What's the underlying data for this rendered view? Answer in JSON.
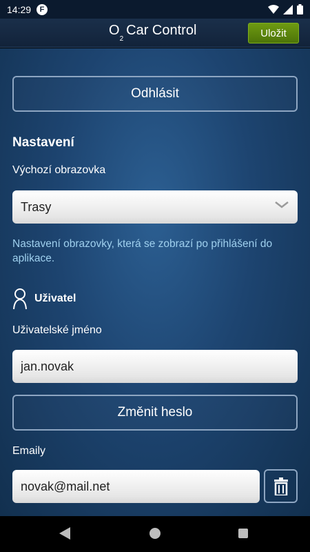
{
  "status": {
    "time": "14:29",
    "app_icon_letter": "F"
  },
  "header": {
    "brand_o": "O",
    "brand_sub": "2",
    "title": "Car Control",
    "save_label": "Uložit"
  },
  "logout_label": "Odhlásit",
  "settings": {
    "title": "Nastavení",
    "default_screen_label": "Výchozí obrazovka",
    "default_screen_value": "Trasy",
    "help_text": "Nastavení obrazovky, která se zobrazí po přihlášení do aplikace."
  },
  "user": {
    "title": "Uživatel",
    "username_label": "Uživatelské jméno",
    "username_value": "jan.novak",
    "change_password_label": "Změnit heslo",
    "emails_label": "Emaily",
    "email_value": "novak@mail.net"
  },
  "colors": {
    "accent_green": "#5a8410",
    "help_text": "#9fd0ee",
    "background": "#1d4470"
  }
}
